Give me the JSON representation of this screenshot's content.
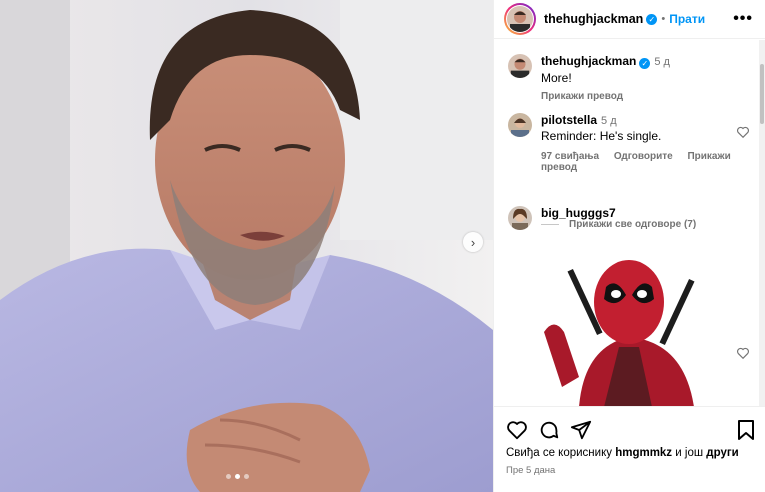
{
  "post": {
    "author": "thehughjackman",
    "header_separator": "•",
    "follow_label": "Прати",
    "more_label": "•••"
  },
  "caption": {
    "author": "thehughjackman",
    "time": "5 д",
    "text": "More!",
    "translate_label": "Прикажи превод"
  },
  "comments": [
    {
      "author": "pilotstella",
      "time": "5 д",
      "text": "Reminder: He's single.",
      "likes": "97 свиђања",
      "reply_label": "Одговорите",
      "translate_label": "Прикажи превод"
    },
    {
      "author": "big_hugggs7",
      "sticker": "deadpool-sticker"
    }
  ],
  "replies_label": "Прикажи све одговоре (7)",
  "likes_line": {
    "prefix": "Свиђа се кориснику",
    "user": "hmgmmkz",
    "middle": "и још",
    "others": "други"
  },
  "posted_ago": "Пре 5 дана",
  "carousel": {
    "slides": 3,
    "active": 1
  },
  "colors": {
    "accent": "#0095f6",
    "muted": "#737373",
    "border": "#efefef"
  }
}
